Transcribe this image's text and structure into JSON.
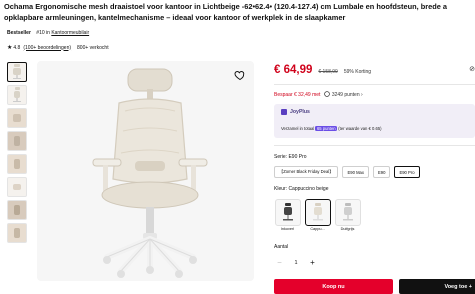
{
  "product": {
    "title_line1": "Ochama Ergonomische mesh draaistoel voor kantoor in Lichtbeige -62•62.4• (120.4-127.4) cm Lumbale en hoofdsteun, brede a",
    "title_line2": "opklapbare armleuningen, kantelmechanisme – ideaal voor kantoor of werkplek in de slaapkamer",
    "bestseller_label": "Bestseller",
    "bestseller_rank": "#10 in",
    "bestseller_category": "Kantoormeubilair",
    "rating": "4.8",
    "reviews": "(100+ beoordelingen)",
    "sold": "800+ verkocht"
  },
  "gallery": {
    "thumbs": [
      "chair-front",
      "chair-side",
      "chair-detail",
      "chair-photo",
      "chair-photo",
      "chair-detail",
      "chair-photo",
      "chair-photo"
    ]
  },
  "pricing": {
    "price": "€ 64,99",
    "old_price": "€ 158,99",
    "discount": "59% Korting",
    "save_text": "Bespaar € 32,49 met",
    "points_text": "3249 punten",
    "accent": "#d0021b"
  },
  "joyplus": {
    "title": "JoyPlus",
    "text_before": "Verzamel in totaal",
    "badge": "65 punten",
    "text_after": "(ter waarde van € 0.65)"
  },
  "serie": {
    "label": "Serie: E90 Pro",
    "options": [
      "【Zomer Black Friday Deal】",
      "E90 Max",
      "E90",
      "E90 Pro"
    ],
    "selected_index": 3
  },
  "kleur": {
    "label": "Kleur: Cappuccino beige",
    "options": [
      "Inkoverl",
      "Cappu...",
      "Duifgrijs"
    ],
    "selected_index": 1
  },
  "quantity": {
    "label": "Aantal",
    "value": "1",
    "minus": "−",
    "plus": "+"
  },
  "actions": {
    "buy_now": "Koop nu",
    "add_to_cart": "Voeg toe +"
  }
}
